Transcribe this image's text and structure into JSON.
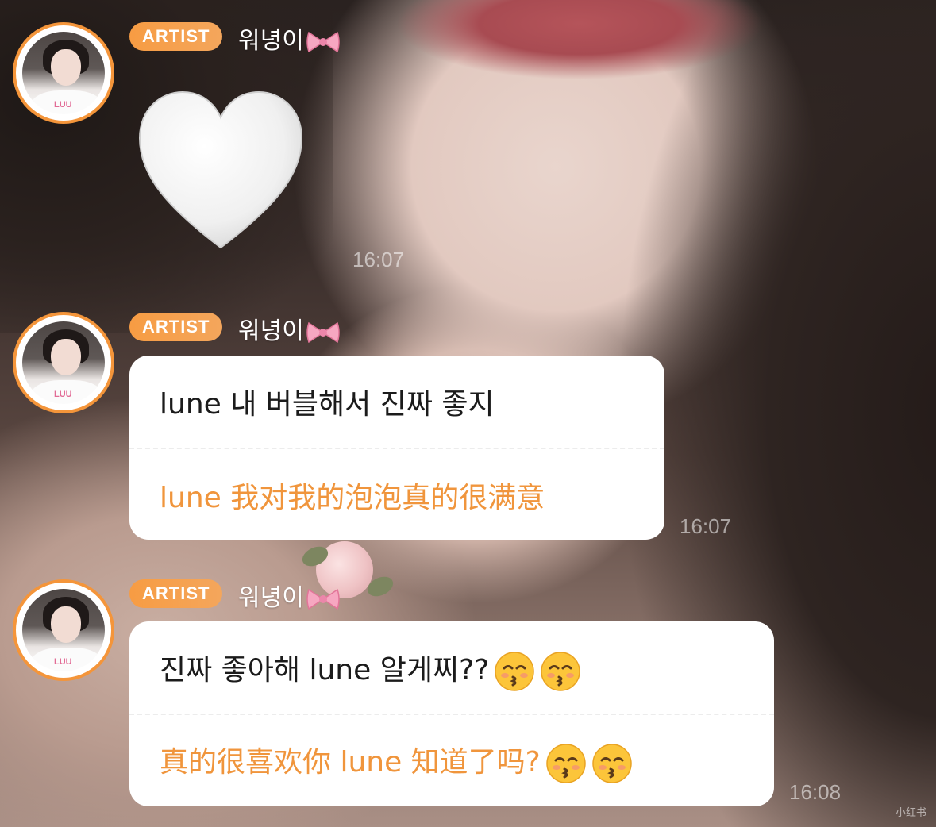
{
  "messages": [
    {
      "badge": "ARTIST",
      "name": "워녕이",
      "name_icon": "ribbon-icon",
      "content_icon": "white-heart-icon",
      "time": "16:07"
    },
    {
      "badge": "ARTIST",
      "name": "워녕이",
      "name_icon": "ribbon-icon",
      "text_ko": "lune 내 버블해서 진짜 좋지",
      "text_zh": "lune 我对我的泡泡真的很满意",
      "time": "16:07"
    },
    {
      "badge": "ARTIST",
      "name": "워녕이",
      "name_icon": "ribbon-icon",
      "text_ko": "진짜 좋아해 lune 알게찌??",
      "text_zh": "真的很喜欢你 lune 知道了吗?",
      "trailing_icons": [
        "kissing-face-icon",
        "kissing-face-icon"
      ],
      "time": "16:08"
    }
  ],
  "watermark": "小红书",
  "colors": {
    "badge": "#f79c43",
    "translation_text": "#f0953c",
    "avatar_ring": "#f4953a"
  }
}
